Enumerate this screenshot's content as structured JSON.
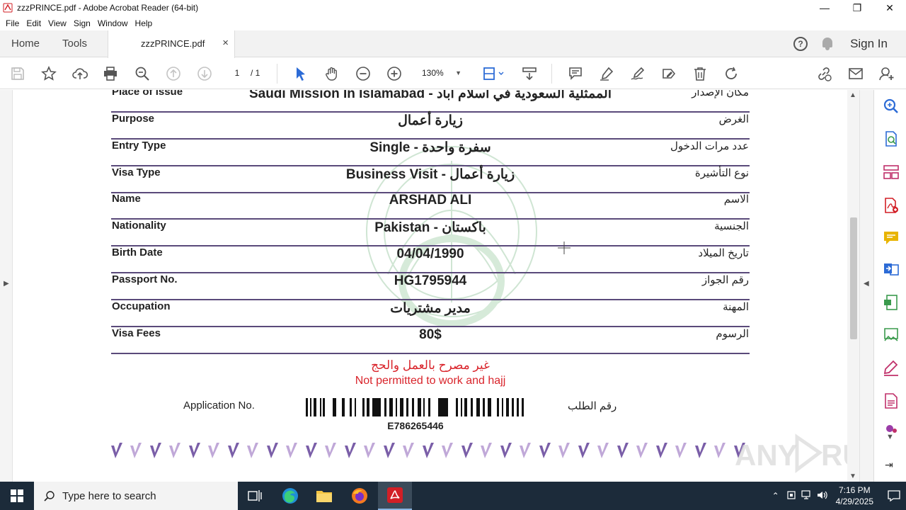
{
  "window": {
    "title": "zzzPRINCE.pdf - Adobe Acrobat Reader (64-bit)",
    "minimize": "—",
    "maximize": "❐",
    "close": "✕"
  },
  "menu": [
    "File",
    "Edit",
    "View",
    "Sign",
    "Window",
    "Help"
  ],
  "tabs": {
    "home": "Home",
    "tools": "Tools",
    "document": "zzzPRINCE.pdf",
    "close": "×",
    "help": "?",
    "signin": "Sign In"
  },
  "toolbar": {
    "page_current": "1",
    "page_total": "/ 1",
    "zoom": "130%"
  },
  "document": {
    "rows": [
      {
        "en": "Place of issue",
        "value": "Saudi Mission In Islamabad - الممثلية السعودية في اسلام اباد",
        "ar": "مكان الإصدار"
      },
      {
        "en": "Purpose",
        "value": "زيارة أعمال",
        "ar": "الغرض"
      },
      {
        "en": "Entry Type",
        "value": "Single - سفرة واحدة",
        "ar": "عدد مرات الدخول"
      },
      {
        "en": "Visa Type",
        "value": "Business Visit - زيارة أعمال",
        "ar": "نوع التأشيرة"
      },
      {
        "en": "Name",
        "value": "ARSHAD ALI",
        "ar": "الاسم"
      },
      {
        "en": "Nationality",
        "value": "Pakistan - باكستان",
        "ar": "الجنسية"
      },
      {
        "en": "Birth Date",
        "value": "04/04/1990",
        "ar": "تاريخ الميلاد"
      },
      {
        "en": "Passport No.",
        "value": "HG1795944",
        "ar": "رقم الجواز"
      },
      {
        "en": "Occupation",
        "value": "مدير مشتريات",
        "ar": "المهنة"
      },
      {
        "en": "Visa Fees",
        "value": "80$",
        "ar": "الرسوم"
      }
    ],
    "notice_ar": "غير مصرح بالعمل والحج",
    "notice_en": "Not permitted to work and hajj",
    "application_label_en": "Application No.",
    "application_label_ar": "رقم الطلب",
    "barcode_number": "E786265446"
  },
  "watermark_text": "ANY RUN",
  "taskbar": {
    "search_placeholder": "Type here to search",
    "time": "7:16 PM",
    "date": "4/29/2025"
  },
  "colors": {
    "row_rule": "#5a4a7a",
    "notice": "#d9242b",
    "acrobat_red": "#d21f26",
    "tools_pink": "#c0306a",
    "tools_blue": "#2c6bd6",
    "tools_green": "#3a9a4c",
    "tools_yellow": "#e8b400",
    "check_purple": "#7a5ea8"
  }
}
